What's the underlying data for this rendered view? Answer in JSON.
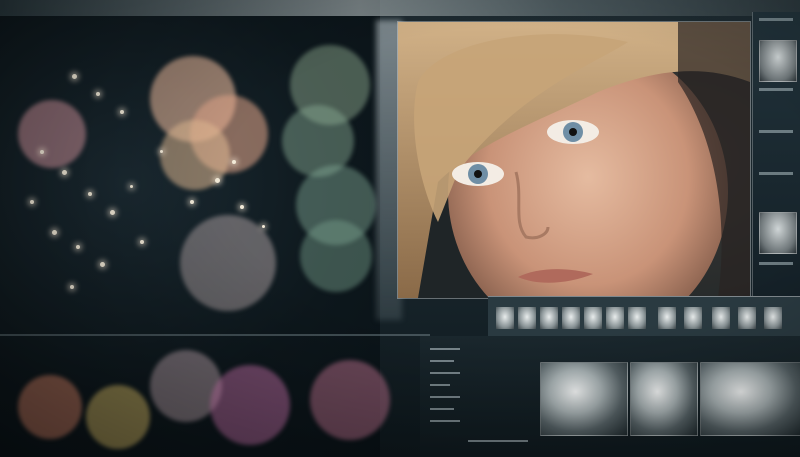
{
  "scene": {
    "description_alt": "",
    "palette": {
      "background": "#0b1418",
      "bokeh_warm": "#e8b59a",
      "bokeh_teal": "#7fa7a0",
      "bokeh_pink": "#d995b8",
      "bokeh_yellow": "#d8c07a",
      "hair": "#b8956a",
      "skin": "#d6a78c",
      "eye": "#6f8ea5"
    },
    "icons": [
      "portrait-photo",
      "thumbnail-strip",
      "image-tile"
    ]
  }
}
